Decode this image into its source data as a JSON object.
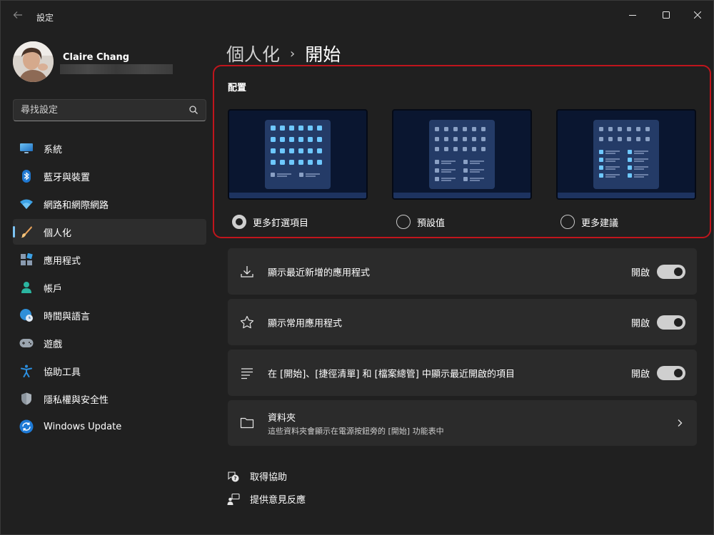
{
  "window": {
    "title": "設定",
    "back_icon": "back-arrow-icon",
    "controls": [
      "minimize-icon",
      "maximize-icon",
      "close-icon"
    ]
  },
  "profile": {
    "name": "Claire Chang",
    "email_redacted": true
  },
  "search": {
    "placeholder": "尋找設定",
    "icon": "search-icon"
  },
  "nav": {
    "items": [
      {
        "label": "系統",
        "icon": "monitor-icon"
      },
      {
        "label": "藍牙與裝置",
        "icon": "bluetooth-icon"
      },
      {
        "label": "網路和網際網路",
        "icon": "wifi-icon"
      },
      {
        "label": "個人化",
        "icon": "paintbrush-icon",
        "active": true
      },
      {
        "label": "應用程式",
        "icon": "apps-icon"
      },
      {
        "label": "帳戶",
        "icon": "person-icon"
      },
      {
        "label": "時間與語言",
        "icon": "globe-clock-icon"
      },
      {
        "label": "遊戲",
        "icon": "gamepad-icon"
      },
      {
        "label": "協助工具",
        "icon": "accessibility-icon"
      },
      {
        "label": "隱私權與安全性",
        "icon": "shield-icon"
      },
      {
        "label": "Windows Update",
        "icon": "windows-update-icon"
      }
    ]
  },
  "header": {
    "parent": "個人化",
    "separator": "›",
    "current": "開始"
  },
  "layout": {
    "title": "配置",
    "options": [
      {
        "label": "更多釘選項目",
        "checked": true
      },
      {
        "label": "預設值",
        "checked": false
      },
      {
        "label": "更多建議",
        "checked": false
      }
    ]
  },
  "settings": [
    {
      "label": "顯示最近新增的應用程式",
      "state": "開啟",
      "on": true,
      "icon": "download-icon"
    },
    {
      "label": "顯示常用應用程式",
      "state": "開啟",
      "on": true,
      "icon": "star-icon"
    },
    {
      "label": "在 [開始]、[捷徑清單] 和 [檔案總管] 中顯示最近開啟的項目",
      "state": "開啟",
      "on": true,
      "icon": "list-icon"
    }
  ],
  "folders": {
    "title": "資料夾",
    "subtitle": "這些資料夾會顯示在電源按鈕旁的 [開始] 功能表中",
    "icon": "folder-icon"
  },
  "footer": {
    "help": "取得協助",
    "feedback": "提供意見反應"
  },
  "colors": {
    "accent": "#7cc4f4",
    "highlight_border": "#c0151c",
    "background": "#202020",
    "card": "#2b2b2b"
  }
}
